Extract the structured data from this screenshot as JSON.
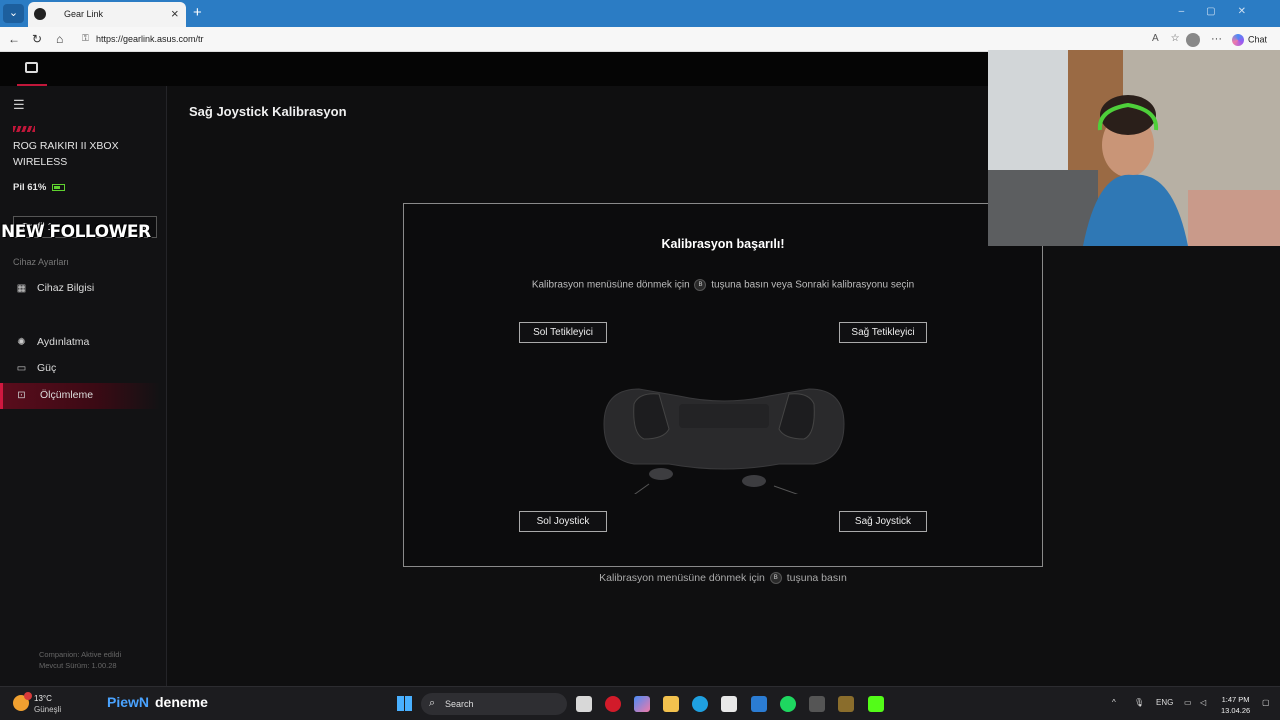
{
  "browser": {
    "tab_title": "Gear Link",
    "url": "https://gearlink.asus.com/tr",
    "chat_label": "Chat"
  },
  "sidebar": {
    "device_name": "ROG RAIKIRI II XBOX WIRELESS",
    "battery_text": "Pil 61%",
    "battery_level": 0.61,
    "profile_value": "Profil 1",
    "section_title": "Cihaz Ayarları",
    "items": [
      {
        "label": "Cihaz Bilgisi",
        "icon": "grid-icon"
      },
      {
        "label": "Aydınlatma",
        "icon": "light-icon"
      },
      {
        "label": "Güç",
        "icon": "battery-icon"
      },
      {
        "label": "Ölçümleme",
        "icon": "calibration-icon"
      }
    ],
    "footer_companion": "Companion: Aktive edildi",
    "footer_version": "Mevcut Sürüm: 1.00.28"
  },
  "overlay": {
    "new_follower": "NEW FOLLOWER",
    "brand_a": "PiewN",
    "brand_b": "deneme"
  },
  "main": {
    "title": "Sağ Joystick Kalibrasyon",
    "panel_title": "Kalibrasyon başarılı!",
    "panel_msg_before": "Kalibrasyon menüsüne dönmek için",
    "panel_msg_button": "B",
    "panel_msg_after": "tuşuna basın veya Sonraki kalibrasyonu seçin",
    "labels": {
      "left_trigger": "Sol Tetikleyici",
      "right_trigger": "Sağ Tetikleyici",
      "left_stick": "Sol Joystick",
      "right_stick": "Sağ Joystick"
    },
    "below_before": "Kalibrasyon menüsüne dönmek için",
    "below_button": "B",
    "below_after": "tuşuna basın"
  },
  "taskbar": {
    "temp": "13°C",
    "weather": "Güneşli",
    "search": "Search",
    "lang": "ENG",
    "time": "1:47 PM",
    "date": "13.04.26"
  },
  "colors": {
    "accent": "#c0173a",
    "battery": "#5fd12f"
  }
}
